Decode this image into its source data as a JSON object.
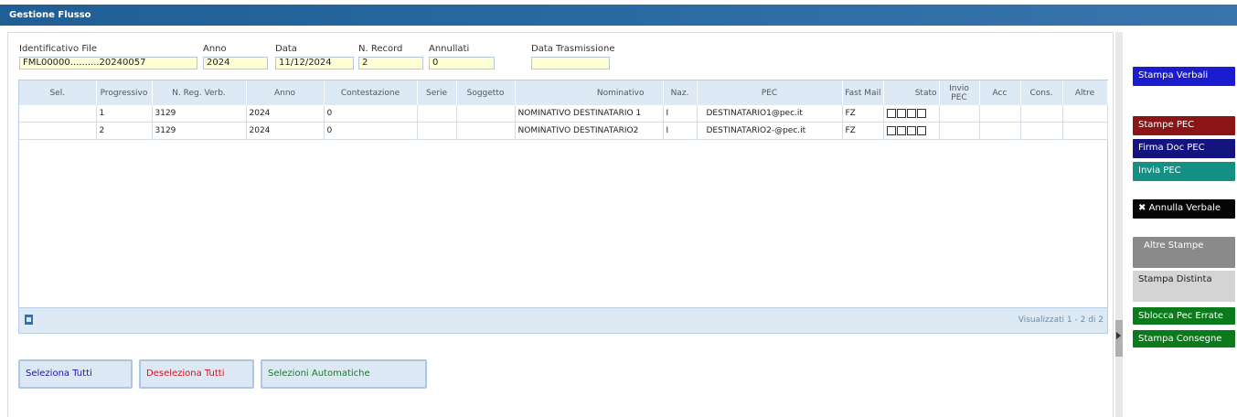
{
  "window": {
    "title": "Gestione Flusso"
  },
  "header_fields": {
    "file_id": {
      "label": "Identificativo File",
      "value": "FML00000..........20240057"
    },
    "anno": {
      "label": "Anno",
      "value": "2024"
    },
    "data": {
      "label": "Data",
      "value": "11/12/2024"
    },
    "n_record": {
      "label": "N. Record",
      "value": "2"
    },
    "annullati": {
      "label": "Annullati",
      "value": "0"
    },
    "data_trasmissione": {
      "label": "Data Trasmissione",
      "value": ""
    }
  },
  "grid": {
    "columns": [
      "Sel.",
      "Progressivo",
      "N. Reg. Verb.",
      "Anno",
      "Contestazione",
      "Serie",
      "Soggetto",
      "Nominativo",
      "Naz.",
      "PEC",
      "Fast Mail",
      "Stato",
      "Invio PEC",
      "Acc",
      "Cons.",
      "Altre"
    ],
    "rows": [
      {
        "sel": "",
        "progressivo": "1",
        "n_reg": "3129",
        "anno": "2024",
        "contestazione": "0",
        "serie": "",
        "soggetto": "",
        "nominativo": "NOMINATIVO DESTINATARIO 1",
        "naz": "I",
        "pec": "DESTINATARIO1@pec.it",
        "fast_mail": "FZ",
        "invio_pec": "",
        "acc": "",
        "cons": "",
        "altre": ""
      },
      {
        "sel": "",
        "progressivo": "2",
        "n_reg": "3129",
        "anno": "2024",
        "contestazione": "0",
        "serie": "",
        "soggetto": "",
        "nominativo": "NOMINATIVO DESTINATARIO2",
        "naz": "I",
        "pec": "DESTINATARIO2-@pec.it",
        "fast_mail": "FZ",
        "invio_pec": "",
        "acc": "",
        "cons": "",
        "altre": ""
      }
    ],
    "pager": "Visualizzati 1 - 2 di 2"
  },
  "selection_buttons": {
    "select_all": "Seleziona Tutti",
    "deselect_all": "Deseleziona Tutti",
    "auto_select": "Selezioni Automatiche"
  },
  "side_buttons": {
    "stampa_verbali": "Stampa Verbali",
    "stampe_pec": "Stampe PEC",
    "firma_doc_pec": "Firma Doc PEC",
    "invia_pec": "Invia PEC",
    "annulla_verbale": "Annulla Verbale",
    "altre_stampe": "Altre Stampe",
    "stampa_distinta": "Stampa Distinta",
    "sblocca_pec_errate": "Sblocca Pec Errate",
    "stampa_consegne": "Stampa Consegne"
  },
  "colors": {
    "title_bar": "#2a6aa3",
    "input_bg": "#ffffd7",
    "grid_header": "#dde9f5",
    "btn_stampa_verbali": "#1b1bd0",
    "btn_stampe_pec": "#8b1414",
    "btn_firma_doc_pec": "#14147e",
    "btn_invia_pec": "#149084",
    "btn_annulla_verbale": "#050505",
    "btn_altre_stampe": "#8a8a8a",
    "btn_stampa_distinta": "#d4d4d4",
    "btn_green": "#0b7a1a"
  }
}
